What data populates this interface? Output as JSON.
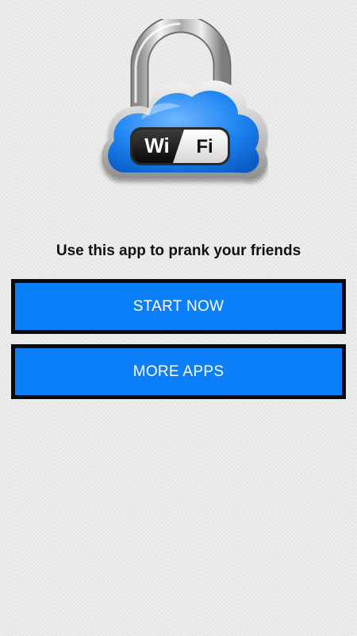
{
  "logo": {
    "icon": "wifi-lock-cloud-icon",
    "badge_left": "Wi",
    "badge_right": "Fi",
    "accent_color": "#1f86f2"
  },
  "tagline": "Use this app to prank your friends",
  "buttons": {
    "start_label": "START NOW",
    "more_label": "MORE APPS",
    "color": "#0a7ff9"
  }
}
